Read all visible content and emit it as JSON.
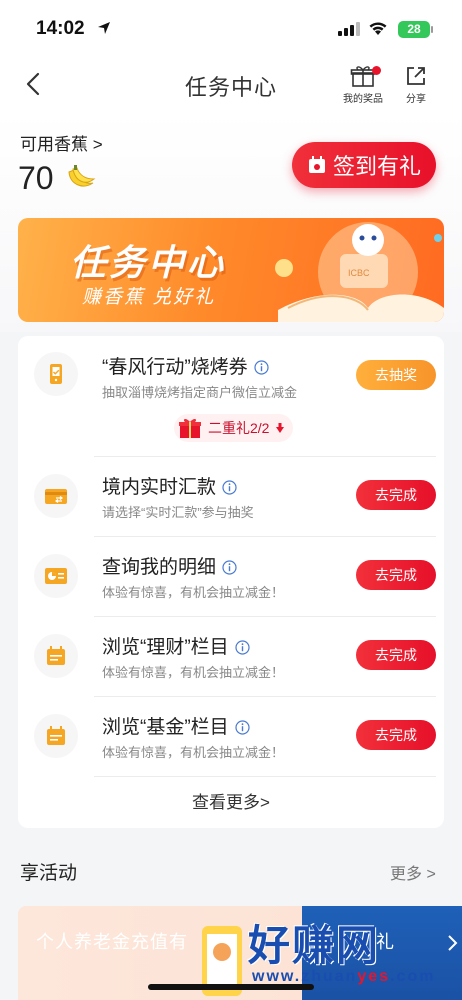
{
  "status": {
    "time": "14:02",
    "battery": "28"
  },
  "header": {
    "title": "任务中心",
    "my_prizes_label": "我的奖品",
    "share_label": "分享"
  },
  "balance": {
    "label": "可用香蕉 >",
    "value": "70"
  },
  "checkin": {
    "label": "签到有礼"
  },
  "banner": {
    "title": "任务中心",
    "subtitle": "赚香蕉 兑好礼",
    "badge": "ICBC"
  },
  "tasks": [
    {
      "title": "“春风行动”烧烤券",
      "desc": "抽取淄博烧烤指定商户微信立减金",
      "button": "去抽奖",
      "icon": "phone-icon"
    },
    {
      "title": "境内实时汇款",
      "desc": "请选择“实时汇款”参与抽奖",
      "button": "去完成",
      "icon": "transfer-card-icon"
    },
    {
      "title": "查询我的明细",
      "desc": "体验有惊喜，有机会抽立减金！",
      "button": "去完成",
      "icon": "statement-icon"
    },
    {
      "title": "浏览“理财”栏目",
      "desc": "体验有惊喜，有机会抽立减金！",
      "button": "去完成",
      "icon": "calendar-icon"
    },
    {
      "title": "浏览“基金”栏目",
      "desc": "体验有惊喜，有机会抽立减金！",
      "button": "去完成",
      "icon": "calendar-icon"
    }
  ],
  "gift_tag": {
    "label": "二重礼2/2"
  },
  "view_more": "查看更多>",
  "activities": {
    "title": "享活动",
    "more": "更多 >",
    "banner_1_text": "个人养老金充值有",
    "banner_2_text": "礼"
  },
  "watermark": {
    "main": "好赚网",
    "url_prefix": "www.zhuan",
    "url_accent": "yes",
    "url_suffix": ".com"
  },
  "colors": {
    "primary_red": "#e8142c",
    "orange": "#f7942a",
    "icon_orange": "#f5a623"
  }
}
